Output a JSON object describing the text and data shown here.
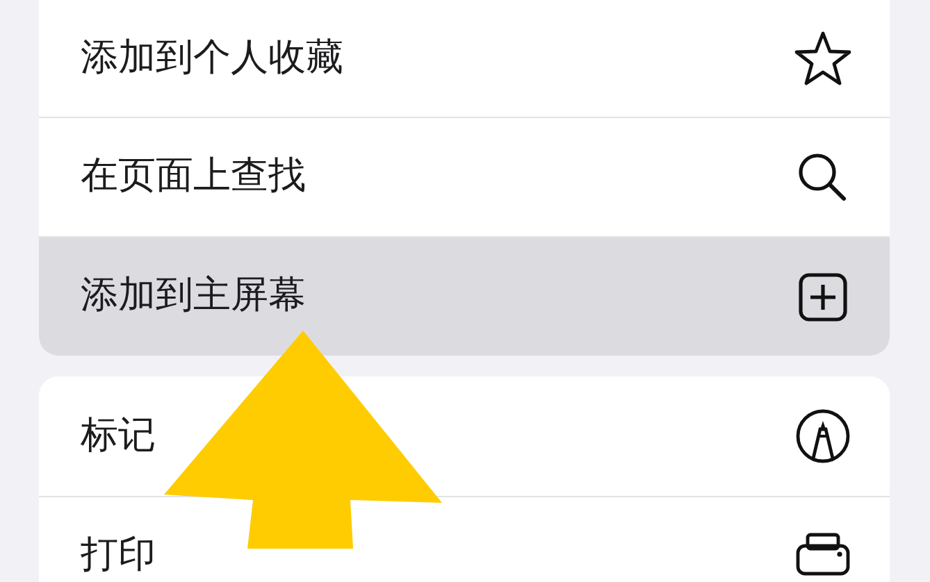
{
  "groups": [
    {
      "items": [
        {
          "label": "添加到个人收藏",
          "kind": "star",
          "selected": false
        },
        {
          "label": "在页面上查找",
          "kind": "search",
          "selected": false
        },
        {
          "label": "添加到主屏幕",
          "kind": "add-square",
          "selected": true
        }
      ]
    },
    {
      "items": [
        {
          "label": "标记",
          "kind": "markup",
          "selected": false
        },
        {
          "label": "打印",
          "kind": "print",
          "selected": false
        }
      ]
    }
  ]
}
